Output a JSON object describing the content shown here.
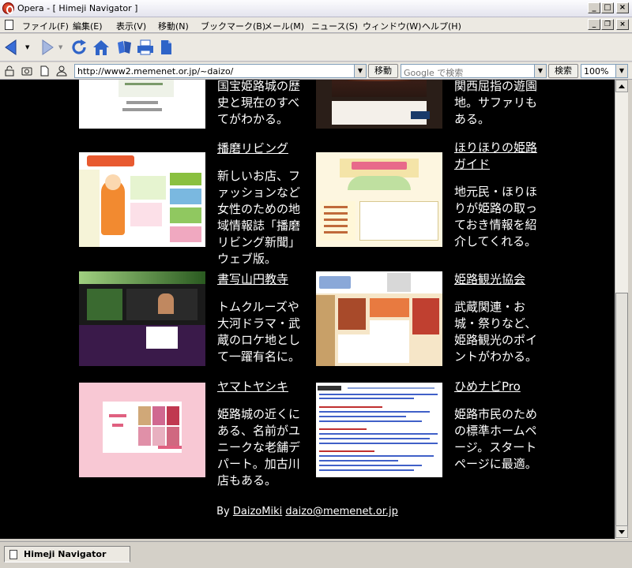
{
  "window": {
    "title": "Opera - [ Himeji Navigator ]",
    "min_label": "_",
    "max_label": "□",
    "close_label": "×"
  },
  "menu": {
    "items": [
      "ファイル(F)",
      "編集(E)",
      "表示(V)",
      "移動(N)",
      "ブックマーク(B)",
      "メール(M)",
      "ニュース(S)",
      "ウィンドウ(W)",
      "ヘルプ(H)"
    ],
    "mdi_min": "_",
    "mdi_restore": "❐",
    "mdi_close": "×"
  },
  "toolbar": {
    "icons": [
      "back-icon",
      "forward-icon",
      "reload-icon",
      "home-icon",
      "hotlist-icon",
      "print-icon",
      "page-icon"
    ]
  },
  "address": {
    "url": "http://www2.memenet.or.jp/~daizo/",
    "go_label": "移動",
    "search_placeholder": "Google で検索",
    "search_label": "検索",
    "zoom": "100%",
    "dropdown_glyph": "▼"
  },
  "sites": [
    {
      "name": "",
      "desc": "国宝姫路城の歴史と現在のすべてがわかる。"
    },
    {
      "name": "",
      "desc": "関西屈指の遊園地。サファリもある。"
    },
    {
      "name": "播磨リビング",
      "desc": "新しいお店、ファッションなど女性のための地域情報誌「播磨リビング新聞」ウェブ版。"
    },
    {
      "name": "ほりほりの姫路ガイド",
      "desc": "地元民・ほりほりが姫路の取っておき情報を紹介してくれる。"
    },
    {
      "name": "書写山円教寺",
      "desc": "トムクルーズや大河ドラマ・武蔵のロケ地として一躍有名に。"
    },
    {
      "name": "姫路観光協会",
      "desc": "武蔵関連・お城・祭りなど、姫路観光のポイントがわかる。"
    },
    {
      "name": "ヤマトヤシキ",
      "desc": "姫路城の近くにある、名前がユニークな老舗デパート。加古川店もある。"
    },
    {
      "name": "ひめナビPro",
      "desc": "姫路市民のための標準ホームページ。スタートページに最適。"
    }
  ],
  "footer": {
    "by": "By",
    "author": "DaizoMiki",
    "email": "daizo@memenet.or.jp"
  },
  "tab": {
    "label": "Himeji Navigator"
  }
}
